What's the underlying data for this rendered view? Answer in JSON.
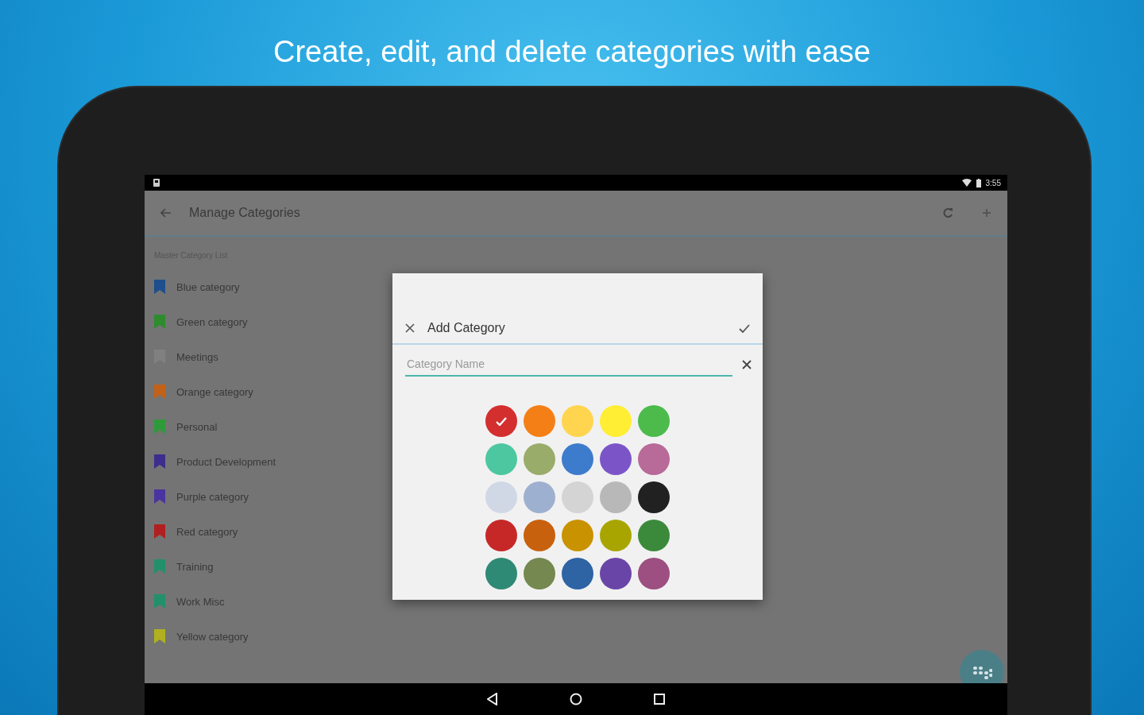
{
  "headline": "Create, edit, and delete categories with ease",
  "status_bar": {
    "time": "3:55"
  },
  "toolbar": {
    "title": "Manage Categories"
  },
  "list": {
    "header": "Master Category List",
    "items": [
      {
        "label": "Blue category",
        "color": "#1f4e8c"
      },
      {
        "label": "Green category",
        "color": "#2e8b2e"
      },
      {
        "label": "Meetings",
        "color": "#808080"
      },
      {
        "label": "Orange category",
        "color": "#c2621a"
      },
      {
        "label": "Personal",
        "color": "#2f9a3a"
      },
      {
        "label": "Product Development",
        "color": "#3d2d8c"
      },
      {
        "label": "Purple category",
        "color": "#4a35a0"
      },
      {
        "label": "Red category",
        "color": "#b02020"
      },
      {
        "label": "Training",
        "color": "#22906a"
      },
      {
        "label": "Work Misc",
        "color": "#22906a"
      },
      {
        "label": "Yellow category",
        "color": "#b0b020"
      }
    ]
  },
  "dialog": {
    "title": "Add Category",
    "field": {
      "placeholder": "Category Name"
    },
    "swatches": [
      {
        "color": "#d32f2f",
        "selected": true
      },
      {
        "color": "#f57f17",
        "selected": false
      },
      {
        "color": "#ffd54f",
        "selected": false
      },
      {
        "color": "#ffee33",
        "selected": false
      },
      {
        "color": "#4cbb4c",
        "selected": false
      },
      {
        "color": "#4dc7a0",
        "selected": false
      },
      {
        "color": "#9aac6a",
        "selected": false
      },
      {
        "color": "#3d7ccc",
        "selected": false
      },
      {
        "color": "#7b55c8",
        "selected": false
      },
      {
        "color": "#b86a98",
        "selected": false
      },
      {
        "color": "#d0d8e6",
        "selected": false
      },
      {
        "color": "#9eb0cf",
        "selected": false
      },
      {
        "color": "#d4d4d4",
        "selected": false
      },
      {
        "color": "#b8b8b8",
        "selected": false
      },
      {
        "color": "#212121",
        "selected": false
      },
      {
        "color": "#c62828",
        "selected": false
      },
      {
        "color": "#c8610e",
        "selected": false
      },
      {
        "color": "#c99200",
        "selected": false
      },
      {
        "color": "#a9a500",
        "selected": false
      },
      {
        "color": "#3b8a3b",
        "selected": false
      },
      {
        "color": "#2e8a74",
        "selected": false
      },
      {
        "color": "#748850",
        "selected": false
      },
      {
        "color": "#2e63a4",
        "selected": false
      },
      {
        "color": "#6a45a8",
        "selected": false
      },
      {
        "color": "#9c4f80",
        "selected": false
      }
    ]
  }
}
